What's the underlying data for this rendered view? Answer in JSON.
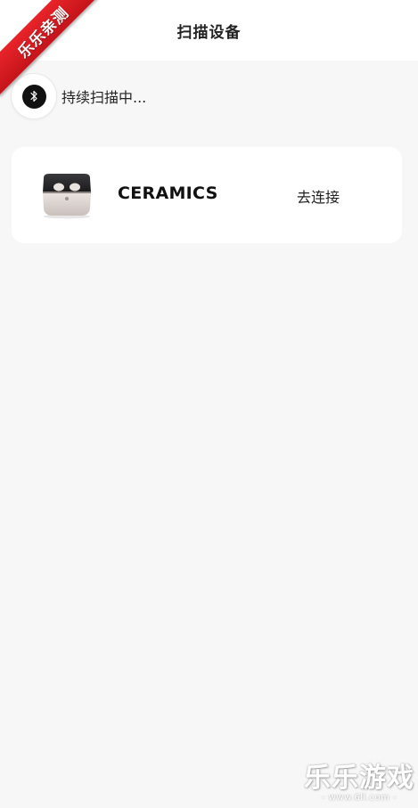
{
  "header": {
    "title": "扫描设备"
  },
  "watermark": {
    "ribbon_text": "乐乐亲测",
    "bottom_main": "乐乐游戏",
    "bottom_sub": "- www.6ll.com -"
  },
  "scan_status": {
    "icon": "bluetooth-icon",
    "label": "持续扫描中..."
  },
  "devices": [
    {
      "image": "earbuds-case-icon",
      "name": "CERAMICS",
      "action_label": "去连接"
    }
  ],
  "colors": {
    "background": "#f7f7f7",
    "card": "#ffffff",
    "ribbon": "#d81c22",
    "text": "#111111"
  }
}
